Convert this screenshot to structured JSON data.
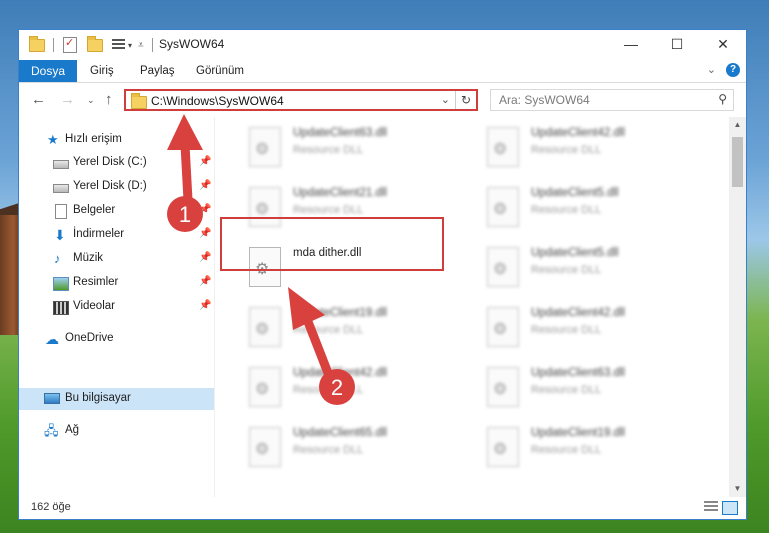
{
  "window": {
    "title": "SysWOW64",
    "controls": {
      "minimize": "—",
      "maximize": "☐",
      "close": "✕"
    }
  },
  "ribbon": {
    "file_tab": "Dosya",
    "tabs": [
      "Giriş",
      "Paylaş",
      "Görünüm"
    ],
    "expand_icon": "chevron-down-icon",
    "help_label": "?"
  },
  "address": {
    "path": "C:\\Windows\\SysWOW64",
    "dropdown": "⌄",
    "refresh": "↻"
  },
  "search": {
    "placeholder": "Ara: SysWOW64"
  },
  "nav": {
    "quick_access": "Hızlı erişim",
    "items": [
      {
        "label": "Yerel Disk (C:)",
        "icon": "drive-icon",
        "pinned": true
      },
      {
        "label": "Yerel Disk (D:)",
        "icon": "drive-icon",
        "pinned": true
      },
      {
        "label": "Belgeler",
        "icon": "documents-icon",
        "pinned": true
      },
      {
        "label": "İndirmeler",
        "icon": "download-icon",
        "pinned": true
      },
      {
        "label": "Müzik",
        "icon": "music-icon",
        "pinned": true
      },
      {
        "label": "Resimler",
        "icon": "pictures-icon",
        "pinned": true
      },
      {
        "label": "Videolar",
        "icon": "videos-icon",
        "pinned": true
      }
    ],
    "onedrive": "OneDrive",
    "this_pc": "Bu bilgisayar",
    "network": "Ağ"
  },
  "files": {
    "left_column": [
      {
        "name": "UpdateClient63.dll",
        "type": "Resource DLL"
      },
      {
        "name": "UpdateClient21.dll",
        "type": "Resource DLL"
      },
      {
        "name": "mda dither.dll",
        "type": ""
      },
      {
        "name": "UpdateClient19.dll",
        "type": "Resource DLL"
      },
      {
        "name": "UpdateClient42.dll",
        "type": "Resource DLL"
      },
      {
        "name": "UpdateClient65.dll",
        "type": "Resource DLL"
      }
    ],
    "right_column": [
      {
        "name": "UpdateClient42.dll",
        "type": "Resource DLL"
      },
      {
        "name": "UpdateClient5.dll",
        "type": "Resource DLL"
      },
      {
        "name": "UpdateClient5.dll",
        "type": "Resource DLL"
      },
      {
        "name": "UpdateClient42.dll",
        "type": "Resource DLL"
      },
      {
        "name": "UpdateClient63.dll",
        "type": "Resource DLL"
      },
      {
        "name": "UpdateClient19.dll",
        "type": "Resource DLL"
      }
    ]
  },
  "status": {
    "item_count": "162 öğe"
  },
  "annotations": {
    "step1": "1",
    "step2": "2",
    "color": "#d9413e"
  }
}
